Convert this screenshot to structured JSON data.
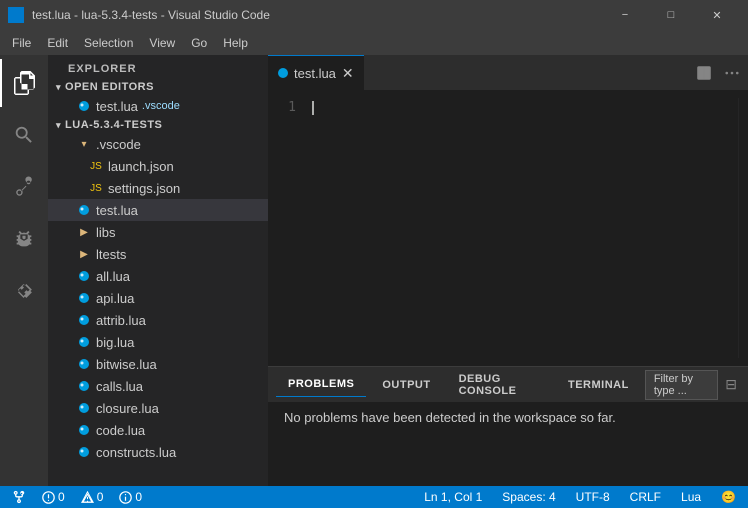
{
  "titlebar": {
    "app_icon": "⬛",
    "title": "test.lua - lua-5.3.4-tests - Visual Studio Code",
    "min_label": "−",
    "max_label": "□",
    "close_label": "✕"
  },
  "menubar": {
    "items": [
      "File",
      "Edit",
      "Selection",
      "View",
      "Go",
      "Help"
    ]
  },
  "activity_bar": {
    "icons": [
      {
        "name": "explorer-icon",
        "glyph": "⬜",
        "active": true
      },
      {
        "name": "search-icon",
        "glyph": "🔍"
      },
      {
        "name": "source-control-icon",
        "glyph": "⑂"
      },
      {
        "name": "debug-icon",
        "glyph": "▷"
      },
      {
        "name": "extensions-icon",
        "glyph": "⊞"
      }
    ]
  },
  "sidebar": {
    "header": "Explorer",
    "sections": {
      "open_editors": {
        "label": "Open Editors",
        "items": [
          {
            "name": "test.lua",
            "badge": ".vscode",
            "icon": "lua"
          }
        ]
      },
      "project": {
        "label": "LUA-5.3.4-TESTS",
        "items": [
          {
            "name": ".vscode",
            "icon": "folder",
            "indent": 1
          },
          {
            "name": "launch.json",
            "icon": "json",
            "indent": 2
          },
          {
            "name": "settings.json",
            "icon": "json",
            "indent": 2
          },
          {
            "name": "test.lua",
            "icon": "lua",
            "indent": 1,
            "active": true
          },
          {
            "name": "libs",
            "icon": "folder-chevron",
            "indent": 1
          },
          {
            "name": "ltests",
            "icon": "folder-chevron",
            "indent": 1
          },
          {
            "name": "all.lua",
            "icon": "lua",
            "indent": 1
          },
          {
            "name": "api.lua",
            "icon": "lua",
            "indent": 1
          },
          {
            "name": "attrib.lua",
            "icon": "lua",
            "indent": 1
          },
          {
            "name": "big.lua",
            "icon": "lua",
            "indent": 1
          },
          {
            "name": "bitwise.lua",
            "icon": "lua",
            "indent": 1
          },
          {
            "name": "calls.lua",
            "icon": "lua",
            "indent": 1
          },
          {
            "name": "closure.lua",
            "icon": "lua",
            "indent": 1
          },
          {
            "name": "code.lua",
            "icon": "lua",
            "indent": 1
          },
          {
            "name": "constructs.lua",
            "icon": "lua",
            "indent": 1
          }
        ]
      }
    }
  },
  "editor": {
    "tab": {
      "filename": "test.lua",
      "icon": "lua"
    },
    "line_numbers": [
      "1"
    ],
    "cursor_line": 1,
    "cursor_col": 1
  },
  "panel": {
    "tabs": [
      "PROBLEMS",
      "OUTPUT",
      "DEBUG CONSOLE",
      "TERMINAL"
    ],
    "active_tab": "PROBLEMS",
    "filter_label": "Filter by type ...",
    "message": "No problems have been detected in the workspace so far."
  },
  "statusbar": {
    "errors": "0",
    "warnings": "0",
    "info": "0",
    "position": "Ln 1, Col 1",
    "spaces": "Spaces: 4",
    "encoding": "UTF-8",
    "line_ending": "CRLF",
    "language": "Lua",
    "smiley": "😊"
  }
}
